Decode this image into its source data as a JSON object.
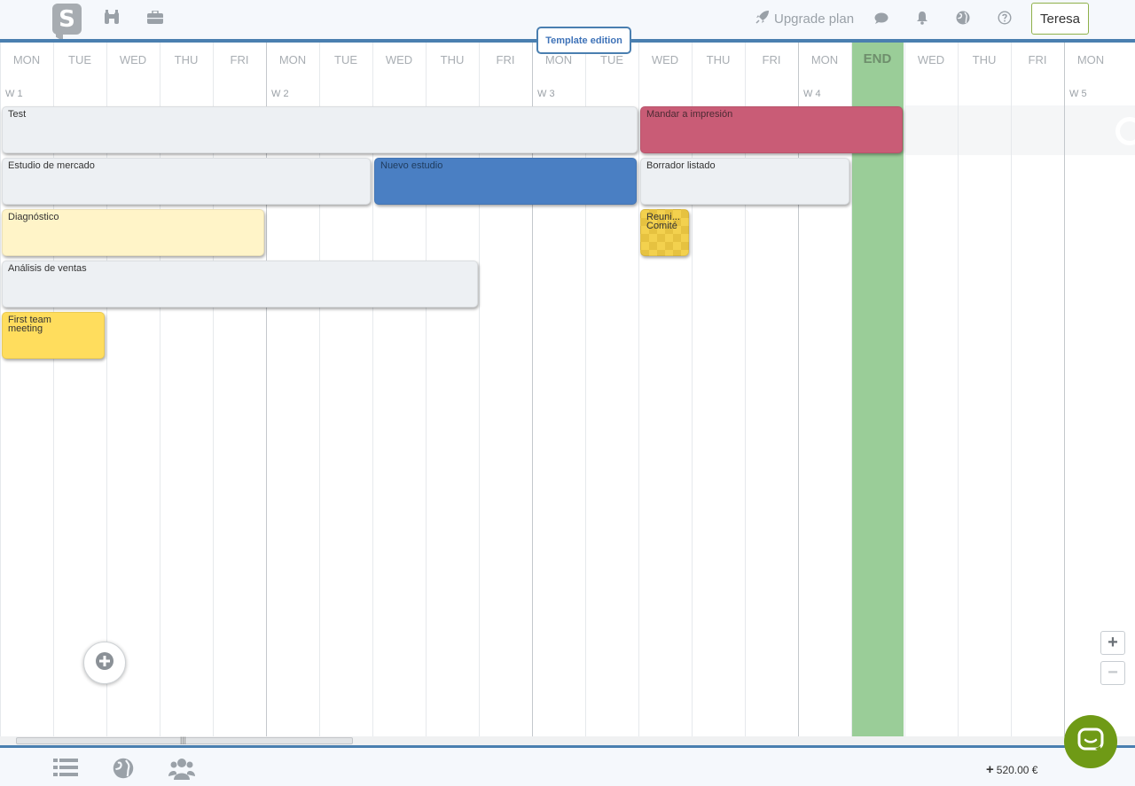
{
  "topbar": {
    "logo_letter": "S",
    "upgrade_label": "Upgrade plan",
    "user_name": "Teresa",
    "template_badge": "Template edition",
    "icons": [
      "binoculars-icon",
      "briefcase-icon",
      "rocket-icon",
      "chat-bubble-icon",
      "bell-icon",
      "globe-icon",
      "help-icon"
    ]
  },
  "timeline": {
    "days": [
      "MON",
      "TUE",
      "WED",
      "THU",
      "FRI",
      "MON",
      "TUE",
      "WED",
      "THU",
      "FRI",
      "MON",
      "TUE",
      "WED",
      "THU",
      "FRI",
      "MON",
      "END",
      "WED",
      "THU",
      "FRI",
      "MON"
    ],
    "weeks": [
      "W 1",
      "W 2",
      "W 3",
      "W 4",
      "W 5"
    ],
    "end_label": "END"
  },
  "tasks": [
    {
      "name": "Test",
      "color": "#edf0f3"
    },
    {
      "name": "Mandar a impresión",
      "color": "#c95c76"
    },
    {
      "name": "Estudio de mercado",
      "color": "#edf0f3"
    },
    {
      "name": "Nuevo estudio",
      "color": "#4a7fc3"
    },
    {
      "name": "Borrador listado",
      "color": "#edf0f3"
    },
    {
      "name": "Diagnóstico",
      "color": "#fff4c8"
    },
    {
      "name": "Reuni...",
      "name_line2": "Comité",
      "color": "#f3d14e"
    },
    {
      "name": "Análisis de ventas",
      "color": "#edf0f3"
    },
    {
      "name": "First team",
      "name_line2": "meeting",
      "color": "#ffdd5d"
    }
  ],
  "controls": {
    "add_icon": "plus-circle-icon",
    "zoom_in": "+",
    "zoom_out": "−",
    "scroll_thumb_grip": "|||"
  },
  "bottombar": {
    "budget_prefix": "+",
    "budget": "520.00 €",
    "icons": [
      "list-icon",
      "globe-icon",
      "team-icon"
    ]
  },
  "colors": {
    "accent": "#4a7fb0",
    "end_column": "#9acd98",
    "chat_button": "#6f9a16",
    "user_border": "#8fb14a"
  }
}
